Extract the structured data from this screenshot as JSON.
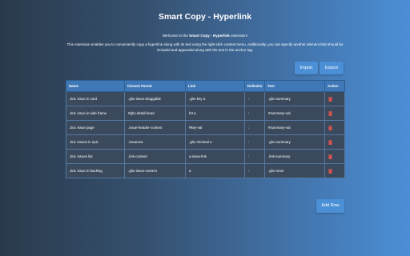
{
  "page": {
    "title": "Smart Copy - Hyperlink",
    "welcome_prefix": "Welcome to the ",
    "welcome_name": "Smart Copy - Hyperlink",
    "welcome_suffix": " extension!",
    "description": "This extension enables you to conveniently copy a hyperlink along with its text using the right-click context menu. Additionally, you can specify another element that should be included and appended along with the text in the anchor tag."
  },
  "toolbar": {
    "import_label": "Import",
    "export_label": "Export"
  },
  "table": {
    "headers": [
      "Name",
      "Closest Parent",
      "Link",
      "Delimiter",
      "Text",
      "Action"
    ],
    "rows": [
      {
        "name": "Jira: issue in card",
        "parent": ".ghx-issue-draggable",
        "link": ".ghx-key a",
        "delimiter": ":",
        "text": ".ghx-summary"
      },
      {
        "name": "Jira: issue in side frame",
        "parent": "#ghx-detail-head",
        "link": "h3 a",
        "delimiter": ":",
        "text": "#summary-val"
      },
      {
        "name": "Jira: issue page",
        "parent": ".issue-header-content",
        "link": "#key-val",
        "delimiter": ":",
        "text": "#summary-val"
      },
      {
        "name": "Jira: issues in epic",
        "parent": ".issuerow",
        "link": ".ghx-minimal a",
        "delimiter": ":",
        "text": ".ghx-summary"
      },
      {
        "name": "Jira: issues list",
        "parent": ".link-content",
        "link": "a.issue-link",
        "delimiter": ":",
        "text": ".link-summary"
      },
      {
        "name": "Jira: issue in backlog",
        "parent": ".ghx-issue-content",
        "link": "a",
        "delimiter": ":",
        "text": ".ghx-inner"
      }
    ]
  },
  "footer": {
    "add_row_label": "Add Row"
  },
  "colors": {
    "accent": "#4b8fd6",
    "delete_icon": "#d9534f"
  },
  "icons": {
    "delete": "trash-icon"
  }
}
